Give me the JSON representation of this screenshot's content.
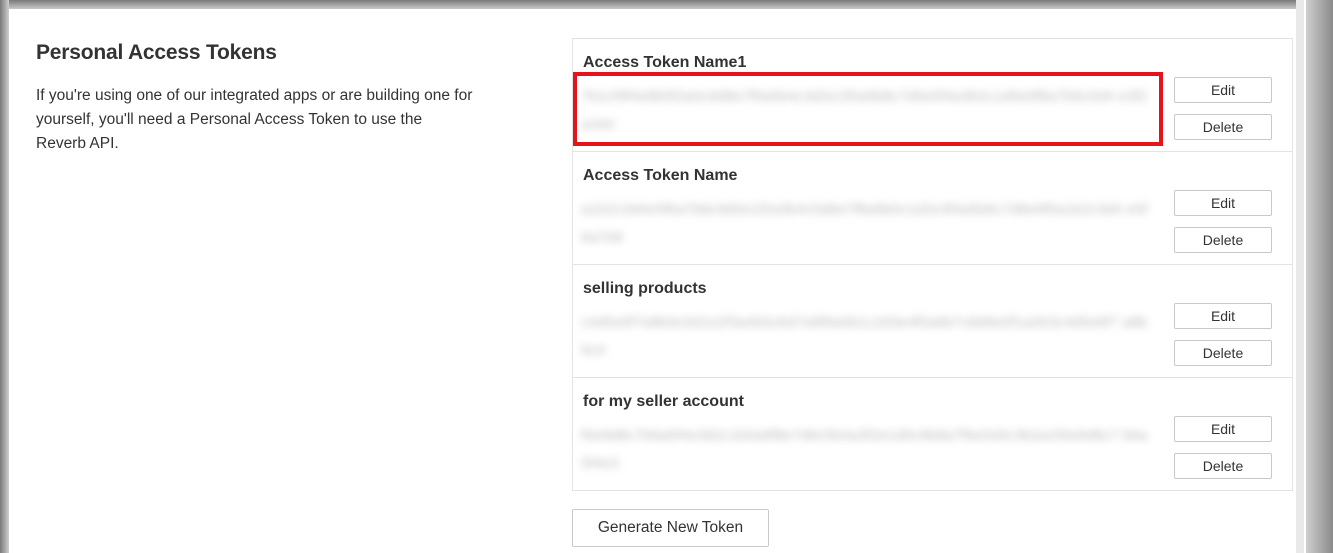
{
  "section": {
    "title": "Personal Access Tokens",
    "description": "If you're using one of our integrated apps or are building one for yourself, you'll need a Personal Access Token to use the Reverb API."
  },
  "tokens": [
    {
      "name": "Access Token Name1",
      "value": "7b1cf9f4e8b5f2a0c9d8e7f6a5b4c3d2e1f0a9b8c7d6e5f4a3b2c1d0e9f8a7b6c5d4 e3f2a1b0",
      "highlighted": true,
      "edit_label": "Edit",
      "delete_label": "Delete"
    },
    {
      "name": "Access Token Name",
      "value": "a1b2c3d4e5f6a7b8c9d0e1f2a3b4c5d6e7f8a9b0c1d2e3f4a5b6c7d8e9f0a1b2c3d4 e5f6a7b8",
      "highlighted": false,
      "edit_label": "Edit",
      "delete_label": "Delete"
    },
    {
      "name": "selling products",
      "value": "c4d5e6f7a8b9c0d1e2f3a4b5c6d7e8f9a0b1c2d3e4f5a6b7c8d9e0f1a2b3c4d5e6f7 a8b9c0",
      "highlighted": false,
      "edit_label": "Edit",
      "delete_label": "Delete"
    },
    {
      "name": "for my seller account",
      "value": "f0e9d8c7b6a5f4e3d2c1b0a9f8e7d6c5b4a3f2e1d0c9b8a7f6e5d4c3b2a1f0e9d8c7 b6a5f4e3",
      "highlighted": false,
      "edit_label": "Edit",
      "delete_label": "Delete"
    }
  ],
  "generate_button_label": "Generate New Token",
  "colors": {
    "highlight": "#e5141b",
    "border": "#e3e3e3",
    "text": "#333333"
  }
}
